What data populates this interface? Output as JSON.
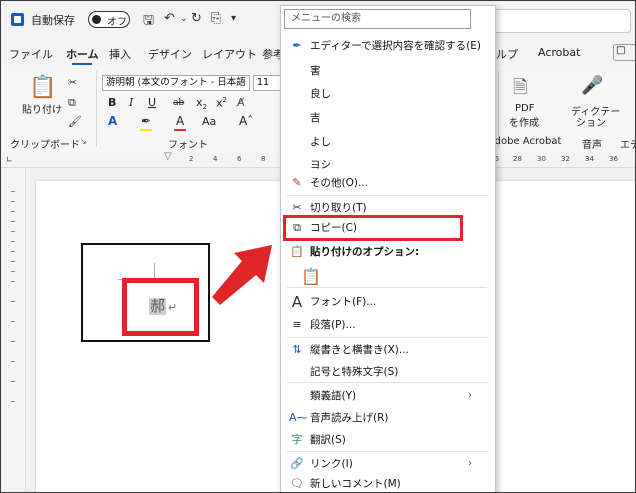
{
  "titlebar": {
    "autosave_label": "自動保存",
    "autosave_toggle": "オフ"
  },
  "tabs": [
    {
      "label": "ファイル"
    },
    {
      "label": "ホーム"
    },
    {
      "label": "挿入"
    },
    {
      "label": "デザイン"
    },
    {
      "label": "レイアウト"
    },
    {
      "label": "参考"
    }
  ],
  "tabs_right": [
    {
      "label": "ヘルプ"
    },
    {
      "label": "Acrobat"
    }
  ],
  "ribbon": {
    "paste_label": "貼り付け",
    "clipboard_group": "クリップボード",
    "font_name": "游明朝 (本文のフォント - 日本語",
    "font_size": "11",
    "font_group": "フォント",
    "pdf_label_1": "PDF",
    "pdf_label_2": "を作成",
    "acrobat_group": "Adobe Acrobat",
    "dictate_label_1": "ディクテー",
    "dictate_label_2": "ション",
    "voice_group": "音声",
    "editor_group_partial": "エデ"
  },
  "ruler": {
    "numbers_left": [
      "2",
      "4",
      "6",
      "8"
    ],
    "numbers_right": [
      "26",
      "28",
      "30",
      "32",
      "34",
      "36"
    ]
  },
  "document": {
    "selected_char": "郝",
    "return_mark": "↵"
  },
  "context_menu": {
    "search_placeholder": "メニューの検索",
    "items": [
      {
        "label": "エディターで選択内容を確認する(E)",
        "icon": "pen-icon"
      },
      {
        "label": "害",
        "icon": ""
      },
      {
        "label": "良し",
        "icon": ""
      },
      {
        "label": "吉",
        "icon": ""
      },
      {
        "label": "よし",
        "icon": ""
      },
      {
        "label": "ヨシ",
        "icon": ""
      },
      {
        "label": "その他(O)...",
        "icon": "more-icon"
      },
      {
        "label": "切り取り(T)",
        "icon": "scissors-icon"
      },
      {
        "label": "コピー(C)",
        "icon": "copy-icon"
      },
      {
        "label": "貼り付けのオプション:",
        "icon": "paste-icon"
      },
      {
        "label": "",
        "icon": "paste-option-icon"
      },
      {
        "label": "フォント(F)...",
        "icon": "font-icon"
      },
      {
        "label": "段落(P)...",
        "icon": "paragraph-icon"
      },
      {
        "label": "縦書きと横書き(X)...",
        "icon": "text-direction-icon"
      },
      {
        "label": "記号と特殊文字(S)",
        "icon": ""
      },
      {
        "label": "類義語(Y)",
        "icon": "",
        "submenu": "›"
      },
      {
        "label": "音声読み上げ(R)",
        "icon": "read-aloud-icon"
      },
      {
        "label": "翻訳(S)",
        "icon": "translate-icon"
      },
      {
        "label": "リンク(I)",
        "icon": "link-icon",
        "submenu": "›"
      },
      {
        "label": "新しいコメント(M)",
        "icon": "comment-icon"
      }
    ]
  },
  "colors": {
    "accent": "#185abd",
    "highlight_red": "#e0262b"
  }
}
